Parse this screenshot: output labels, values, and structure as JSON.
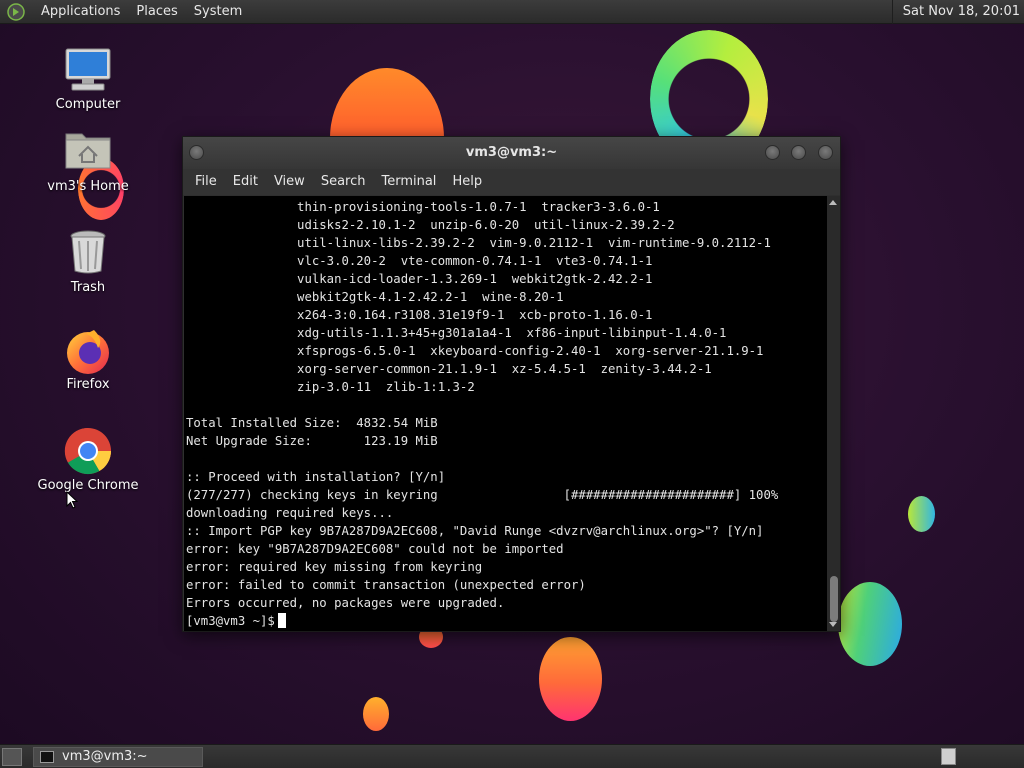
{
  "top_panel": {
    "menus": [
      "Applications",
      "Places",
      "System"
    ],
    "clock": "Sat Nov 18, 20:01"
  },
  "desktop_icons": [
    {
      "label": "Computer",
      "icon": "computer-icon"
    },
    {
      "label": "vm3's Home",
      "icon": "home-folder-icon"
    },
    {
      "label": "Trash",
      "icon": "trash-icon"
    },
    {
      "label": "Firefox",
      "icon": "firefox-icon"
    },
    {
      "label": "Google Chrome",
      "icon": "chrome-icon"
    }
  ],
  "window": {
    "title": "vm3@vm3:~",
    "menus": [
      "File",
      "Edit",
      "View",
      "Search",
      "Terminal",
      "Help"
    ]
  },
  "terminal": {
    "lines": [
      "               thin-provisioning-tools-1.0.7-1  tracker3-3.6.0-1",
      "               udisks2-2.10.1-2  unzip-6.0-20  util-linux-2.39.2-2",
      "               util-linux-libs-2.39.2-2  vim-9.0.2112-1  vim-runtime-9.0.2112-1",
      "               vlc-3.0.20-2  vte-common-0.74.1-1  vte3-0.74.1-1",
      "               vulkan-icd-loader-1.3.269-1  webkit2gtk-2.42.2-1",
      "               webkit2gtk-4.1-2.42.2-1  wine-8.20-1",
      "               x264-3:0.164.r3108.31e19f9-1  xcb-proto-1.16.0-1",
      "               xdg-utils-1.1.3+45+g301a1a4-1  xf86-input-libinput-1.4.0-1",
      "               xfsprogs-6.5.0-1  xkeyboard-config-2.40-1  xorg-server-21.1.9-1",
      "               xorg-server-common-21.1.9-1  xz-5.4.5-1  zenity-3.44.2-1",
      "               zip-3.0-11  zlib-1:1.3-2",
      "",
      "Total Installed Size:  4832.54 MiB",
      "Net Upgrade Size:       123.19 MiB",
      "",
      ":: Proceed with installation? [Y/n]",
      "(277/277) checking keys in keyring                 [######################] 100%",
      "downloading required keys...",
      ":: Import PGP key 9B7A287D9A2EC608, \"David Runge <dvzrv@archlinux.org>\"? [Y/n]",
      "error: key \"9B7A287D9A2EC608\" could not be imported",
      "error: required key missing from keyring",
      "error: failed to commit transaction (unexpected error)",
      "Errors occurred, no packages were upgraded."
    ],
    "prompt": "[vm3@vm3 ~]$"
  },
  "bottom_panel": {
    "task_label": "vm3@vm3:~"
  },
  "colors": {
    "terminal_bg": "#000000",
    "terminal_fg": "#e4e4e4",
    "panel_bg": "#2f2f2f"
  }
}
